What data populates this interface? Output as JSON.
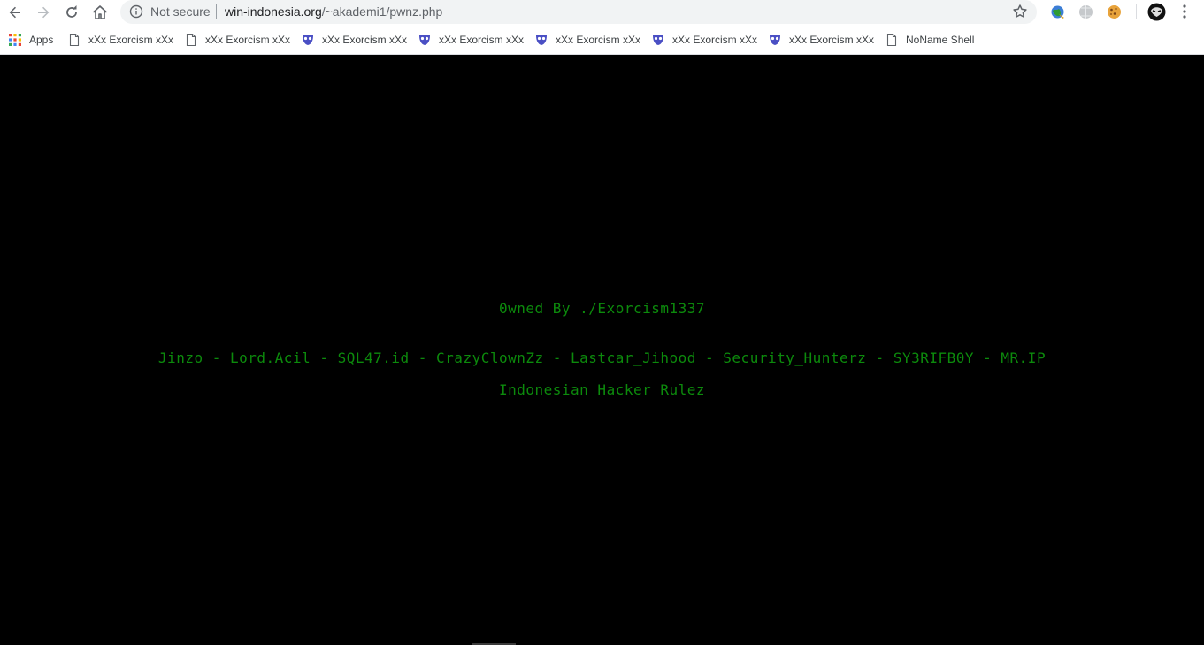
{
  "browser": {
    "not_secure_label": "Not secure",
    "url_host": "win-indonesia.org",
    "url_path": "/~akademi1/pwnz.php"
  },
  "bookmarks": [
    {
      "label": "Apps",
      "icon": "apps-grid-icon"
    },
    {
      "label": "xXx Exorcism xXx",
      "icon": "page-icon"
    },
    {
      "label": "xXx Exorcism xXx",
      "icon": "page-icon"
    },
    {
      "label": "xXx Exorcism xXx",
      "icon": "mask-icon"
    },
    {
      "label": "xXx Exorcism xXx",
      "icon": "mask-icon"
    },
    {
      "label": "xXx Exorcism xXx",
      "icon": "mask-icon"
    },
    {
      "label": "xXx Exorcism xXx",
      "icon": "mask-icon"
    },
    {
      "label": "xXx Exorcism xXx",
      "icon": "mask-icon"
    },
    {
      "label": "NoName Shell",
      "icon": "page-icon"
    }
  ],
  "page": {
    "owned_line": "0wned By ./Exorcism1337",
    "members_line": "Jinzo - Lord.Acil - SQL47.id - CrazyClownZz - Lastcar_Jihood - Security_Hunterz - SY3RIFB0Y - MR.IP",
    "rulez_line": "Indonesian Hacker Rulez",
    "text_color": "#0c8a0c",
    "background_color": "#000000"
  }
}
